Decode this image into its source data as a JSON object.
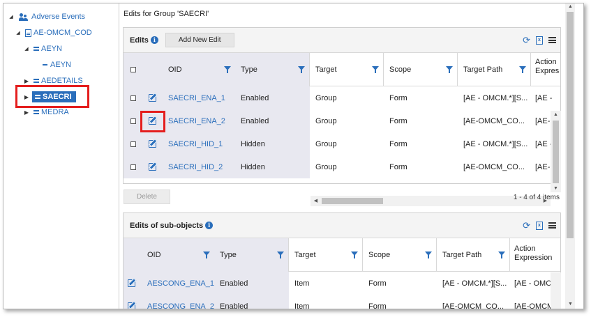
{
  "tree": {
    "root": "Adverse Events",
    "form": "AE-OMCM_COD",
    "group1": "AEYN",
    "item1": "AEYN",
    "group2": "AEDETAILS",
    "group3": "SAECRI",
    "group4": "MEDRA"
  },
  "main": {
    "title": "Edits for Group 'SAECRI'",
    "edits_panel": {
      "title": "Edits",
      "add_button": "Add New Edit",
      "columns": [
        "OID",
        "Type",
        "Target",
        "Scope",
        "Target Path",
        "Action Expression"
      ],
      "rows": [
        {
          "oid": "SAECRI_ENA_1",
          "type": "Enabled",
          "target": "Group",
          "scope": "Form",
          "path": "[AE - OMCM.*][S...",
          "action": "[AE - "
        },
        {
          "oid": "SAECRI_ENA_2",
          "type": "Enabled",
          "target": "Group",
          "scope": "Form",
          "path": "[AE-OMCM_CO...",
          "action": "[AE-C"
        },
        {
          "oid": "SAECRI_HID_1",
          "type": "Hidden",
          "target": "Group",
          "scope": "Form",
          "path": "[AE - OMCM.*][S...",
          "action": "[AE - "
        },
        {
          "oid": "SAECRI_HID_2",
          "type": "Hidden",
          "target": "Group",
          "scope": "Form",
          "path": "[AE-OMCM_CO...",
          "action": "[AE-C"
        }
      ],
      "delete_button": "Delete",
      "pager": "1 - 4 of 4 items"
    },
    "sub_panel": {
      "title": "Edits of sub-objects",
      "columns": [
        "OID",
        "Type",
        "Target",
        "Scope",
        "Target Path",
        "Action Expression"
      ],
      "rows": [
        {
          "oid": "AESCONG_ENA_1",
          "type": "Enabled",
          "target": "Item",
          "scope": "Form",
          "path": "[AE - OMCM.*][S...",
          "action": "[AE - OMCM"
        },
        {
          "oid": "AESCONG_ENA_2",
          "type": "Enabled",
          "target": "Item",
          "scope": "Form",
          "path": "[AE-OMCM_CO...",
          "action": "[AE-OMCM_"
        }
      ]
    }
  },
  "colors": {
    "accent": "#2a6ebb",
    "highlight": "#e41e1e",
    "locked_bg": "#e8e8f0"
  },
  "icons": [
    "refresh-icon",
    "excel-icon",
    "menu-icon",
    "edit-icon",
    "filter-icon",
    "info-icon"
  ]
}
